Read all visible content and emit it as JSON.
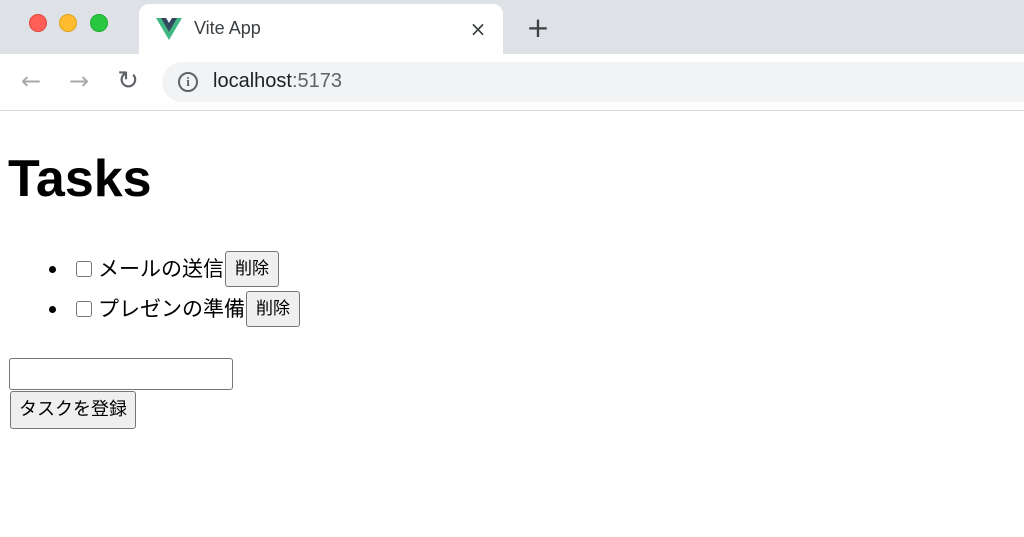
{
  "browser": {
    "tab_title": "Vite App",
    "tab_close_glyph": "×",
    "new_tab_glyph": "+",
    "url_host": "localhost",
    "url_port": ":5173",
    "traffic_lights": {
      "close": "#ff5f57",
      "minimize": "#febc2e",
      "maximize": "#28c840"
    },
    "favicon_colors": {
      "outer": "#41b883",
      "inner": "#35495e"
    }
  },
  "page": {
    "title": "Tasks",
    "tasks": [
      {
        "label": "メールの送信",
        "checked": false,
        "delete_label": "削除"
      },
      {
        "label": "プレゼンの準備",
        "checked": false,
        "delete_label": "削除"
      }
    ],
    "new_task_value": "",
    "submit_label": "タスクを登録"
  }
}
